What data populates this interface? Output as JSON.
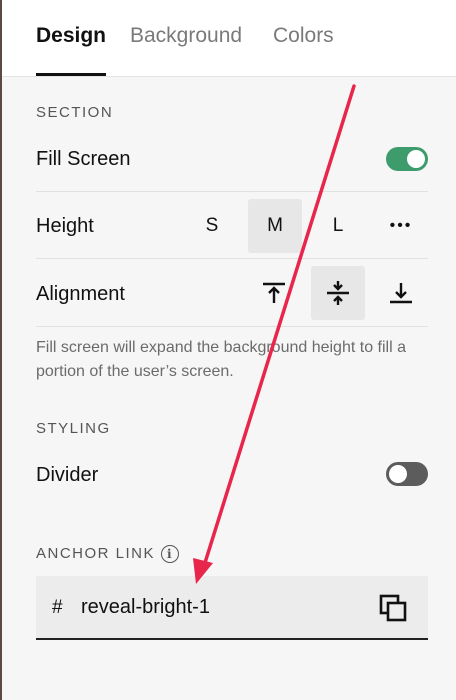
{
  "tabs": [
    {
      "label": "Design",
      "active": true
    },
    {
      "label": "Background",
      "active": false
    },
    {
      "label": "Colors",
      "active": false
    }
  ],
  "section": {
    "heading": "SECTION",
    "fill_screen": {
      "label": "Fill Screen",
      "enabled": true
    },
    "height": {
      "label": "Height",
      "options": [
        "S",
        "M",
        "L",
        "•••"
      ],
      "selected": "M"
    },
    "alignment": {
      "label": "Alignment",
      "options": [
        "top",
        "center",
        "bottom"
      ],
      "selected": "center"
    },
    "helper_text": "Fill screen will expand the background height to fill a portion of the user’s screen."
  },
  "styling": {
    "heading": "STYLING",
    "divider": {
      "label": "Divider",
      "enabled": false
    }
  },
  "anchor": {
    "heading": "ANCHOR LINK",
    "prefix": "#",
    "value": "reveal-bright-1"
  },
  "colors": {
    "toggle_on": "#3e9b6b",
    "toggle_off": "#5c5c5c",
    "annotation_arrow": "#e8264b"
  }
}
